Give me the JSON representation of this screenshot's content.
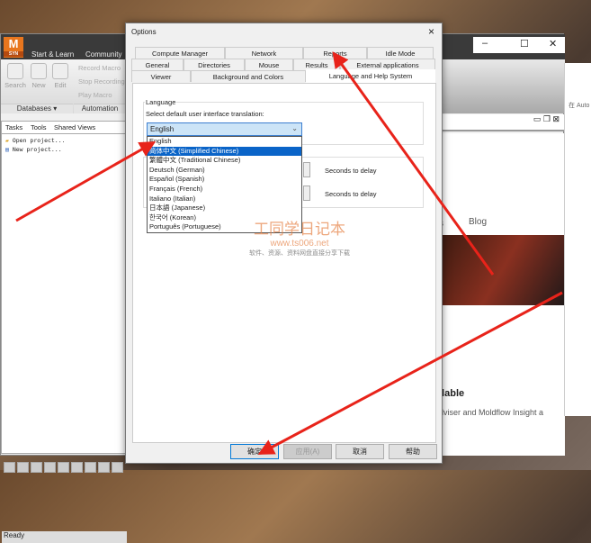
{
  "app": {
    "logo": "M",
    "logo_sub": "SYN",
    "tabs": [
      "Start & Learn",
      "Community"
    ],
    "ribbon": {
      "buttons": [
        "Search",
        "New",
        "Edit"
      ],
      "group_databases": "Databases ▾",
      "macros": [
        "Record Macro",
        "Stop Recording",
        "Play Macro"
      ],
      "group_automation": "Automation"
    },
    "left_tabs": [
      "Tasks",
      "Tools",
      "Shared Views"
    ],
    "left_items": [
      "Open project...",
      "New project..."
    ],
    "status": "Ready"
  },
  "web": {
    "nav_partial": "s",
    "blog": "Blog",
    "heading_partial": "ilable",
    "text_partial": "dviser and Moldflow Insight a"
  },
  "far_right": {
    "text": "在 Auto"
  },
  "dialog": {
    "title": "Options",
    "close": "×",
    "tabs_row1": [
      "Compute Manager",
      "Network",
      "Reports",
      "Idle Mode"
    ],
    "tabs_row2": [
      "General",
      "Directories",
      "Mouse",
      "Results",
      "External applications"
    ],
    "tabs_row3": [
      "Viewer",
      "Background and Colors",
      "Language and Help System"
    ],
    "group_language": "Language",
    "select_label": "Select default user interface translation:",
    "selected": "English",
    "options": [
      "English",
      "简体中文 (Simplified Chinese)",
      "繁體中文 (Traditional Chinese)",
      "Deutsch (German)",
      "Español (Spanish)",
      "Français (French)",
      "Italiano (Italian)",
      "日本語 (Japanese)",
      "한국어 (Korean)",
      "Português (Portuguese)"
    ],
    "highlighted_index": 1,
    "delay_label1": "Seconds to delay",
    "delay_label2": "Seconds to delay",
    "buttons": {
      "ok": "确定",
      "apply": "应用(A)",
      "cancel": "取消",
      "help": "帮助"
    }
  },
  "watermark": {
    "title": "工同学日记本",
    "url": "www.ts006.net",
    "sub": "软件、资源、资料网盘直接分享下载"
  },
  "colors": {
    "accent": "#0a64c8",
    "arrow": "#e8231a",
    "logo": "#e8761e"
  }
}
